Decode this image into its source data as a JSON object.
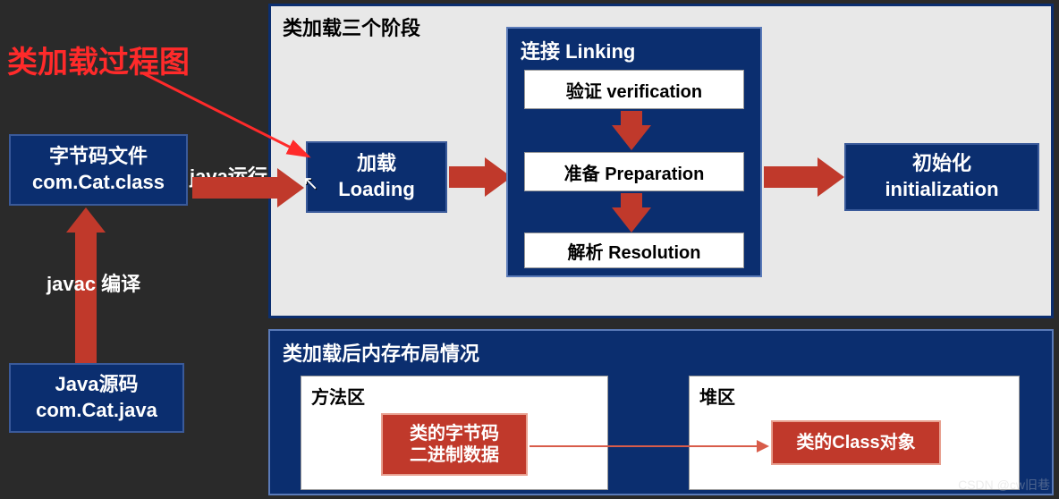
{
  "title": "类加载过程图",
  "left": {
    "source_label1": "Java源码",
    "source_label2": "com.Cat.java",
    "compile_label": "javac 编译",
    "bytecode_label1": "字节码文件",
    "bytecode_label2": "com.Cat.class",
    "run_label": "java运行"
  },
  "stages": {
    "panel_title": "类加载三个阶段",
    "loading_label1": "加载",
    "loading_label2": "Loading",
    "linking": {
      "title": "连接 Linking",
      "verification": "验证 verification",
      "preparation": "准备 Preparation",
      "resolution": "解析 Resolution"
    },
    "init_label1": "初始化",
    "init_label2": "initialization"
  },
  "memory": {
    "panel_title": "类加载后内存布局情况",
    "method_area_label": "方法区",
    "bytecode_data1": "类的字节码",
    "bytecode_data2": "二进制数据",
    "heap_label": "堆区",
    "class_obj": "类的Class对象"
  },
  "watermark": "CSDN @cw旧巷"
}
